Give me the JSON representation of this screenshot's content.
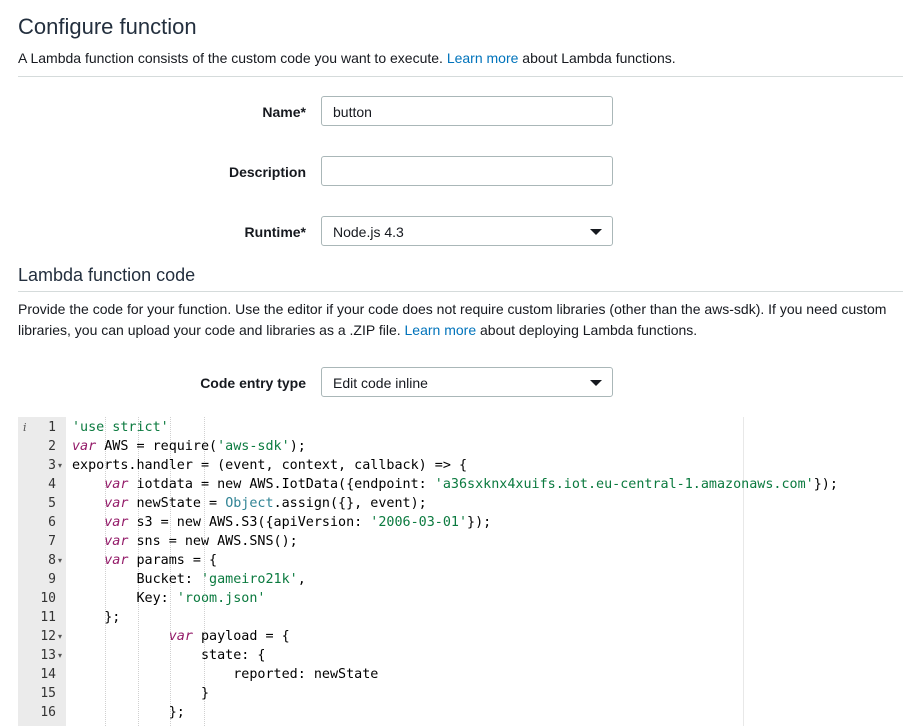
{
  "configure": {
    "title": "Configure function",
    "description_before": "A Lambda function consists of the custom code you want to execute. ",
    "learn_more": "Learn more",
    "description_after": " about Lambda functions."
  },
  "form": {
    "name_label": "Name*",
    "name_value": "button",
    "description_label": "Description",
    "description_value": "",
    "runtime_label": "Runtime*",
    "runtime_value": "Node.js 4.3"
  },
  "code_section": {
    "title": "Lambda function code",
    "description_before": "Provide the code for your function. Use the editor if your code does not require custom libraries (other than the aws-sdk). If you need custom libraries, you can upload your code and libraries as a .ZIP file. ",
    "learn_more": "Learn more",
    "description_after": " about deploying Lambda functions.",
    "entry_type_label": "Code entry type",
    "entry_type_value": "Edit code inline"
  },
  "editor": {
    "line_numbers": [
      "1",
      "2",
      "3",
      "4",
      "5",
      "6",
      "7",
      "8",
      "9",
      "10",
      "11",
      "12",
      "13",
      "14",
      "15",
      "16"
    ],
    "lines": [
      [
        {
          "t": "'use strict'",
          "c": "str2"
        }
      ],
      [
        {
          "t": "var",
          "c": "kw"
        },
        {
          "t": " AWS = require(",
          "c": ""
        },
        {
          "t": "'aws-sdk'",
          "c": "str2"
        },
        {
          "t": ");",
          "c": ""
        }
      ],
      [
        {
          "t": "exports.handler = (event, context, callback) => {",
          "c": ""
        }
      ],
      [
        {
          "t": "    ",
          "c": ""
        },
        {
          "t": "var",
          "c": "kw"
        },
        {
          "t": " iotdata = new AWS.IotData({endpoint: ",
          "c": ""
        },
        {
          "t": "'a36sxknx4xuifs.iot.eu-central-1.amazonaws.com'",
          "c": "str2"
        },
        {
          "t": "});",
          "c": ""
        }
      ],
      [
        {
          "t": "    ",
          "c": ""
        },
        {
          "t": "var",
          "c": "kw"
        },
        {
          "t": " newState = ",
          "c": ""
        },
        {
          "t": "Object",
          "c": "obj"
        },
        {
          "t": ".assign({}, event);",
          "c": ""
        }
      ],
      [
        {
          "t": "    ",
          "c": ""
        },
        {
          "t": "var",
          "c": "kw"
        },
        {
          "t": " s3 = new AWS.S3({apiVersion: ",
          "c": ""
        },
        {
          "t": "'2006-03-01'",
          "c": "str2"
        },
        {
          "t": "});",
          "c": ""
        }
      ],
      [
        {
          "t": "    ",
          "c": ""
        },
        {
          "t": "var",
          "c": "kw"
        },
        {
          "t": " sns = new AWS.SNS();",
          "c": ""
        }
      ],
      [
        {
          "t": "    ",
          "c": ""
        },
        {
          "t": "var",
          "c": "kw"
        },
        {
          "t": " params = {",
          "c": ""
        }
      ],
      [
        {
          "t": "        Bucket: ",
          "c": ""
        },
        {
          "t": "'gameiro21k'",
          "c": "str2"
        },
        {
          "t": ",",
          "c": ""
        }
      ],
      [
        {
          "t": "        Key: ",
          "c": ""
        },
        {
          "t": "'room.json'",
          "c": "str2"
        }
      ],
      [
        {
          "t": "    };",
          "c": ""
        }
      ],
      [
        {
          "t": "            ",
          "c": ""
        },
        {
          "t": "var",
          "c": "kw"
        },
        {
          "t": " payload = {",
          "c": ""
        }
      ],
      [
        {
          "t": "                state: {",
          "c": ""
        }
      ],
      [
        {
          "t": "                    reported: newState",
          "c": ""
        }
      ],
      [
        {
          "t": "                }",
          "c": ""
        }
      ],
      [
        {
          "t": "            };",
          "c": ""
        }
      ]
    ],
    "fold_markers": [
      "3",
      "8",
      "12",
      "13"
    ],
    "info_marker_line": "1"
  }
}
